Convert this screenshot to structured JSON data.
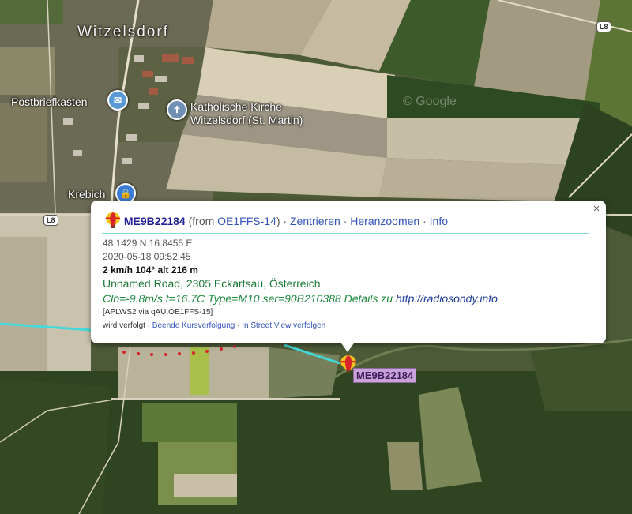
{
  "colors": {
    "track": "#44d8d8",
    "balloon_red": "#d8242a",
    "balloon_yellow": "#f4c21c",
    "popup_rule": "#7fd6dc",
    "link_blue": "#3355bb",
    "green_text": "#1f7a3a",
    "marker_label_bg": "#c8a2d8"
  },
  "map": {
    "town_label": "Witzelsdorf",
    "poi_mail": {
      "label": "Postbriefkasten",
      "icon": "mail-icon"
    },
    "poi_church": {
      "label_line1": "Katholische Kirche",
      "label_line2": "Witzelsdorf (St. Martin)",
      "icon": "church-cross-icon"
    },
    "poi_shop": {
      "label": "Krebich",
      "icon": "shopping-bag-icon"
    },
    "road_badge_1": "L8",
    "road_badge_2": "L8",
    "watermark": "© Google"
  },
  "popup": {
    "balloon_icon": "balloon-icon",
    "callsign": "ME9B22184",
    "from_prefix": "(from ",
    "from_station": "OE1FFS-14",
    "from_suffix": ")",
    "sep1": " · ",
    "link_center": "Zentrieren",
    "sep2": " · ",
    "link_zoom": "Heranzoomen",
    "sep3": " · ",
    "link_info": "Info",
    "close_label": "×",
    "coords": "48.1429 N 16.8455 E",
    "timestamp": "2020-05-18 09:52:45",
    "speed_course_alt": "2 km/h 104° alt 216 m",
    "address": "Unnamed Road, 2305 Eckartsau, Österreich",
    "comment": "Clb=-9.8m/s t=16.7C Type=M10 ser=90B210388 Details zu ",
    "comment_link": "http://radiosondy.info",
    "path": "[APLWS2 via qAU,OE1FFS-15]",
    "tracked_prefix": "wird verfolgt · ",
    "link_stop_tracking": "Beende Kursverfolgung",
    "sep4": " · ",
    "link_street_view": "In Street View verfolgen"
  },
  "marker": {
    "label": "ME9B22184",
    "icon": "balloon-icon"
  }
}
